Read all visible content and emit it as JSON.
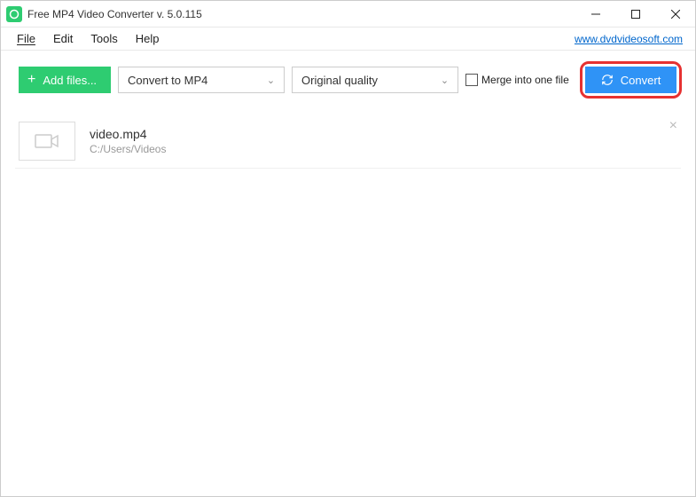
{
  "titlebar": {
    "title": "Free MP4 Video Converter v. 5.0.115"
  },
  "menubar": {
    "file": "File",
    "edit": "Edit",
    "tools": "Tools",
    "help": "Help",
    "link": "www.dvdvideosoft.com"
  },
  "toolbar": {
    "add_files": "Add files...",
    "format_selected": "Convert to MP4",
    "quality_selected": "Original quality",
    "merge_label": "Merge into one file",
    "convert": "Convert"
  },
  "files": {
    "item0": {
      "name": "video.mp4",
      "path": "C:/Users/Videos"
    }
  }
}
